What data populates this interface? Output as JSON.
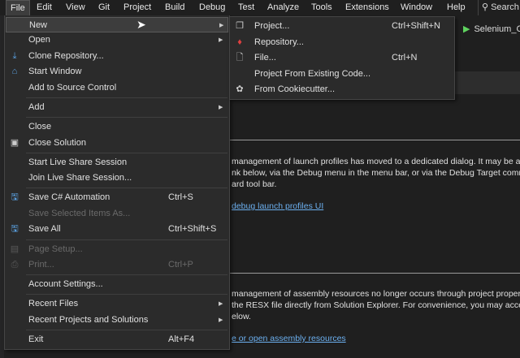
{
  "menubar": {
    "items": [
      "File",
      "Edit",
      "View",
      "Git",
      "Project",
      "Build",
      "Debug",
      "Test",
      "Analyze",
      "Tools",
      "Extensions",
      "Window",
      "Help"
    ],
    "search": "Search"
  },
  "toolbar": {
    "run_target": "Selenium_C"
  },
  "content": {
    "p1": [
      "management of launch profiles has moved to a dedicated dialog. It may be ac",
      "nk below, via the Debug menu in the menu bar, or via the Debug Target comm",
      "ard tool bar."
    ],
    "link1": "debug launch profiles UI",
    "p2": [
      "management of assembly resources no longer occurs through project propert",
      "the RESX file directly from Solution Explorer. For convenience, you may acce",
      "elow."
    ],
    "link2": "e or open assembly resources"
  },
  "file_menu": {
    "items": [
      {
        "label": "New",
        "submenu": true,
        "highlighted": true
      },
      {
        "label": "Open",
        "submenu": true
      },
      {
        "label": "Clone Repository...",
        "icon": "download-icon"
      },
      {
        "label": "Start Window",
        "icon": "start-window-icon"
      },
      {
        "label": "Add to Source Control"
      },
      {
        "label": "Add",
        "submenu": true
      },
      {
        "label": "Close"
      },
      {
        "label": "Close Solution",
        "icon": "close-solution-icon"
      },
      {
        "label": "Start Live Share Session"
      },
      {
        "label": "Join Live Share Session..."
      },
      {
        "label": "Save C# Automation",
        "shortcut": "Ctrl+S",
        "icon": "save-icon"
      },
      {
        "label": "Save Selected Items As...",
        "disabled": true
      },
      {
        "label": "Save All",
        "shortcut": "Ctrl+Shift+S",
        "icon": "save-all-icon"
      },
      {
        "label": "Page Setup...",
        "disabled": true,
        "icon": "page-setup-icon"
      },
      {
        "label": "Print...",
        "shortcut": "Ctrl+P",
        "disabled": true,
        "icon": "print-icon"
      },
      {
        "label": "Account Settings..."
      },
      {
        "label": "Recent Files",
        "submenu": true
      },
      {
        "label": "Recent Projects and Solutions",
        "submenu": true
      },
      {
        "label": "Exit",
        "shortcut": "Alt+F4"
      }
    ]
  },
  "new_submenu": {
    "items": [
      {
        "label": "Project...",
        "shortcut": "Ctrl+Shift+N",
        "icon": "new-project-icon"
      },
      {
        "label": "Repository...",
        "icon": "new-repository-icon"
      },
      {
        "label": "File...",
        "shortcut": "Ctrl+N",
        "icon": "new-file-icon"
      },
      {
        "label": "Project From Existing Code..."
      },
      {
        "label": "From Cookiecutter...",
        "icon": "cookiecutter-icon"
      }
    ]
  }
}
